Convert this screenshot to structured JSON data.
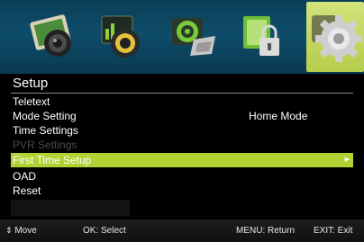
{
  "top_icons": [
    {
      "icon": "picture-icon"
    },
    {
      "icon": "sound-icon"
    },
    {
      "icon": "channel-icon"
    },
    {
      "icon": "lock-icon"
    },
    {
      "icon": "setup-gear-icon",
      "selected": true
    }
  ],
  "colors": {
    "accent": "#b2d234",
    "header_bg": "#0e4d6a",
    "disabled_text": "#4a4a4a"
  },
  "menu": {
    "title": "Setup",
    "items": [
      {
        "label": "Teletext",
        "value": ""
      },
      {
        "label": "Mode Setting",
        "value": "Home Mode"
      },
      {
        "label": "Time Settings",
        "value": ""
      },
      {
        "label": "PVR Settings",
        "value": "",
        "disabled": true
      },
      {
        "label": "First Time Setup",
        "value": "",
        "selected": true
      },
      {
        "label": "OAD",
        "value": ""
      },
      {
        "label": "Reset",
        "value": ""
      }
    ]
  },
  "help_bar": {
    "move_icon": "⇕",
    "move": "Move",
    "select": "OK: Select",
    "return": "MENU: Return",
    "exit": "EXIT: Exit"
  }
}
